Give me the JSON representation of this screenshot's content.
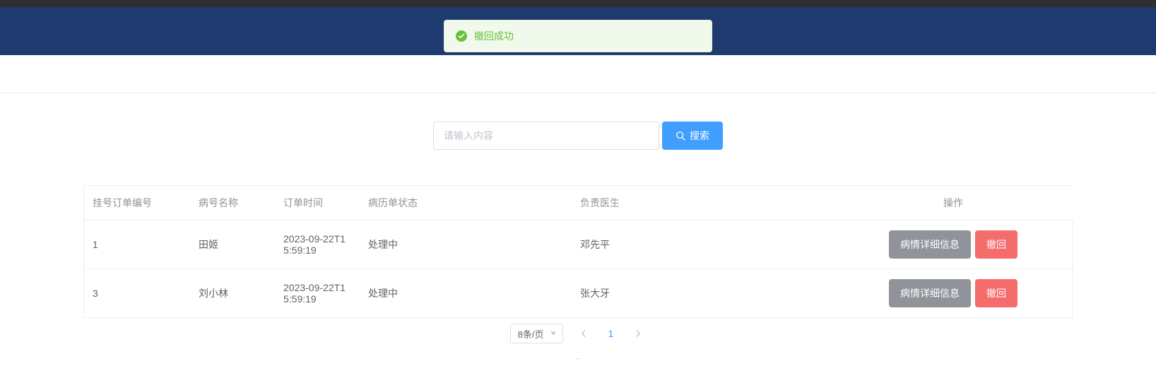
{
  "toast": {
    "message": "撤回成功"
  },
  "search": {
    "placeholder": "请输入内容",
    "button_label": "搜索"
  },
  "table": {
    "headers": {
      "order_id": "挂号订单编号",
      "patient_name": "病号名称",
      "order_time": "订单时间",
      "record_status": "病历单状态",
      "doctor": "负责医生",
      "blank": "",
      "operate": "操作"
    },
    "rows": [
      {
        "order_id": "1",
        "patient_name": "田姬",
        "order_time": "2023-09-22T15:59:19",
        "record_status": "处理中",
        "doctor": "邓先平",
        "detail_label": "病情详细信息",
        "withdraw_label": "撤回"
      },
      {
        "order_id": "3",
        "patient_name": "刘小林",
        "order_time": "2023-09-22T15:59:19",
        "record_status": "处理中",
        "doctor": "张大牙",
        "detail_label": "病情详细信息",
        "withdraw_label": "撤回"
      }
    ]
  },
  "pagination": {
    "page_size_label": "8条/页",
    "current_page": "1"
  }
}
